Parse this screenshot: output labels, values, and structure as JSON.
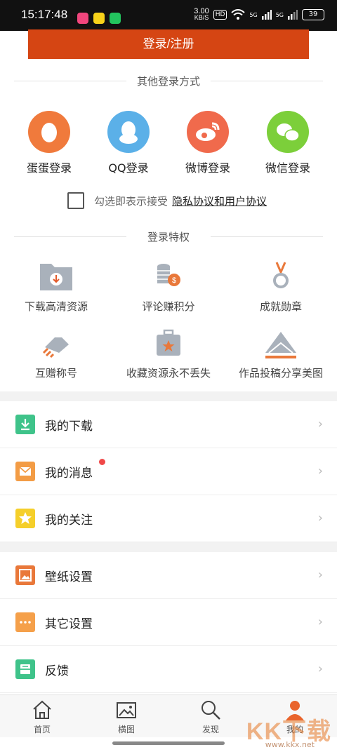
{
  "status_bar": {
    "time": "15:17:48",
    "net_speed_value": "3.00",
    "net_speed_unit": "KB/S",
    "hd_badge": "HD",
    "signal_1": "5G",
    "signal_2": "5G",
    "battery": "39",
    "app_icons": [
      "#f0467d",
      "#f7d21a",
      "#23c45e"
    ]
  },
  "login_button": "登录/注册",
  "other_login": {
    "title": "其他登录方式",
    "options": [
      {
        "label": "蛋蛋登录",
        "icon": "egg-icon",
        "color": "#f07a3c"
      },
      {
        "label": "QQ登录",
        "icon": "qq-penguin-icon",
        "color": "#5bb0e8"
      },
      {
        "label": "微博登录",
        "icon": "weibo-icon",
        "color": "#f06a4c"
      },
      {
        "label": "微信登录",
        "icon": "wechat-icon",
        "color": "#7ccf3a"
      }
    ]
  },
  "agreement": {
    "prefix": "勾选即表示接受",
    "link": "隐私协议和用户协议"
  },
  "perks": {
    "title": "登录特权",
    "items": [
      {
        "label": "下载高清资源",
        "icon": "download-folder-icon"
      },
      {
        "label": "评论赚积分",
        "icon": "coins-icon"
      },
      {
        "label": "成就勋章",
        "icon": "medal-icon"
      },
      {
        "label": "互赠称号",
        "icon": "handshake-icon"
      },
      {
        "label": "收藏资源永不丢失",
        "icon": "star-briefcase-icon"
      },
      {
        "label": "作品投稿分享美图",
        "icon": "envelope-submit-icon"
      }
    ]
  },
  "menu_group_1": [
    {
      "label": "我的下载",
      "icon": "download-icon",
      "color": "#3fc38a"
    },
    {
      "label": "我的消息",
      "icon": "mail-icon",
      "color": "#f39c45"
    },
    {
      "label": "我的关注",
      "icon": "star-icon",
      "color": "#f5cf2a"
    }
  ],
  "menu_group_2": [
    {
      "label": "壁纸设置",
      "icon": "wallpaper-icon",
      "color": "#e9783a"
    },
    {
      "label": "其它设置",
      "icon": "more-icon",
      "color": "#f5a04a"
    },
    {
      "label": "反馈",
      "icon": "feedback-icon",
      "color": "#3fc38a"
    }
  ],
  "tabs": [
    {
      "label": "首页",
      "icon": "home-icon"
    },
    {
      "label": "横图",
      "icon": "image-icon"
    },
    {
      "label": "发现",
      "icon": "search-icon"
    },
    {
      "label": "我的",
      "icon": "user-icon"
    }
  ],
  "accent_color": "#d54513",
  "watermark": {
    "logo": "KK下载",
    "url": "www.kkx.net"
  }
}
